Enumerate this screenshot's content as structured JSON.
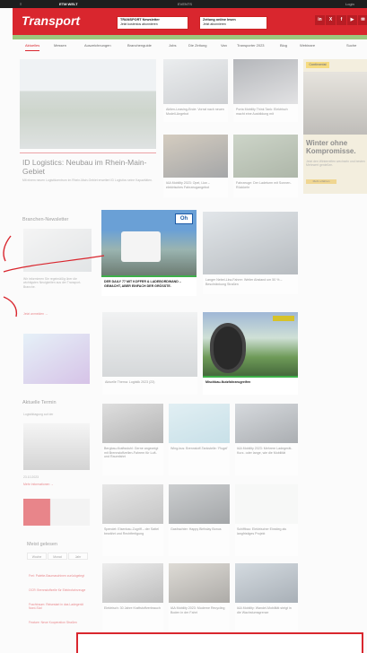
{
  "topbar": {
    "left": "≡",
    "center_logo": "ETM WELT",
    "mid": "EVENTS",
    "right": "Login"
  },
  "header": {
    "logo": "Transport",
    "box1": {
      "title": "TRANSPORT Newsletter",
      "sub": "Jetzt kostenlos abonnieren"
    },
    "box2": {
      "title": "Zeitung online lesen",
      "sub": "Jetzt abonnieren"
    },
    "social": [
      "in",
      "X",
      "f",
      "▶",
      "✉"
    ]
  },
  "nav": [
    "Aktuelles",
    "Messen",
    "Auszeichnungen",
    "Branchenguide",
    "Jobs",
    "Die Zeitung",
    "Van",
    "Transporter 2023",
    "Blog",
    "Webinare",
    "Suche"
  ],
  "hero": {
    "title": "ID Logistics: Neubau im Rhein-Main-Gebiet",
    "teaser": "Mit einem neuen Logistikzentrum im Rhein-Main-Gebiet erweitert ID Logistics seine Kapazitäten."
  },
  "topcards": [
    {
      "caption": "Aktien-Leasing-Ende: Vorrat nach neuen Modell-Angebot"
    },
    {
      "caption": "Porta Mobility Think Tank: Elektrisch macht eine Ausbildung mit"
    },
    {
      "caption": "IAA Mobility 2023: Opel, Lkw – elektrisches Fahrzeugangebot"
    },
    {
      "caption": "Fahrzeuge: Der Ladeturm mit Sonnen-Rückkehr"
    }
  ],
  "ad": {
    "brand": "Continental",
    "headline": "Winter ohne Kompromisse.",
    "sub": "Jetzt den Winterreifen wechseln und besten Mehrwert genießen.",
    "button": "Mehr erfahren"
  },
  "newsletter": {
    "heading": "Branchen-Newsletter",
    "text": "Wir informieren Sie regelmäßig über die wichtigsten Neuigkeiten aus der Transport-Branche.",
    "link": "Jetzt anmelden →"
  },
  "midcards": [
    {
      "caption": "DER DAILY 77 MIT KOFFER & LADEBORDWAND – GEMACHT, ABER EINFACH DER GRÖSSTE."
    },
    {
      "caption": "Langer Nebel-Lkw-Fahrer: Weiter Abstand um 50 % – Beschränkung Straßen"
    },
    {
      "caption": "Aktuelle Thema: Logistik 2023 (23)"
    },
    {
      "caption": "Mischbau-Nutzfahrzeugreifen"
    }
  ],
  "termin": {
    "heading": "Aktuelle Termin",
    "sub": "Logistiktagung auf der",
    "date": "23.10.2023",
    "link": "Mehr Informationen →"
  },
  "grid": [
    {
      "caption": "Bergbau-Kraftsstuhl: Gerne angezeigt mit Brennstoffzellen-Fahrern für Luft- und Raumfahrt"
    },
    {
      "caption": "Wing-bus: Brennstoff-Tankstelle: 'Flugel'"
    },
    {
      "caption": "IAA Mobility 2023: Mehrere Ladegerät-Kurz- oder lange, wie die Mobilität"
    },
    {
      "caption": "Spendet: Eisenbau-Zugriff – der Sattel bewährt und Rechtfertigung"
    },
    {
      "caption": "Gasfrachter: Happy Birthday Bonus"
    },
    {
      "caption": "Schiffbau: Elektrischer Einstieg als langfristiges Projekt"
    },
    {
      "caption": "Elektrisch: 30 Jahre Kraftstoffverbrauch"
    },
    {
      "caption": "IAA Mobility 2023: Moderne Recycling Boden in der Fahrt"
    },
    {
      "caption": "IAA Mobility: Wandel-Mobilität steigt in die Wachstumsgrenze"
    }
  ],
  "meist": {
    "heading": "Meist gelesen",
    "tabs": [
      "Woche",
      "Monat",
      "Jahr"
    ],
    "items": [
      "Frei: Palette-Baumaschinen zurückgelegt",
      "OCR: Brennstoffzelle für Elektrofahrzeuge",
      "Frachtraum: Reisestart in das Ladegerät Nord-Süd",
      "Feature: Neue Kooperation Straßen"
    ]
  },
  "colors": {
    "brand_red": "#d9262e",
    "green_bar": "#9dc77e"
  }
}
